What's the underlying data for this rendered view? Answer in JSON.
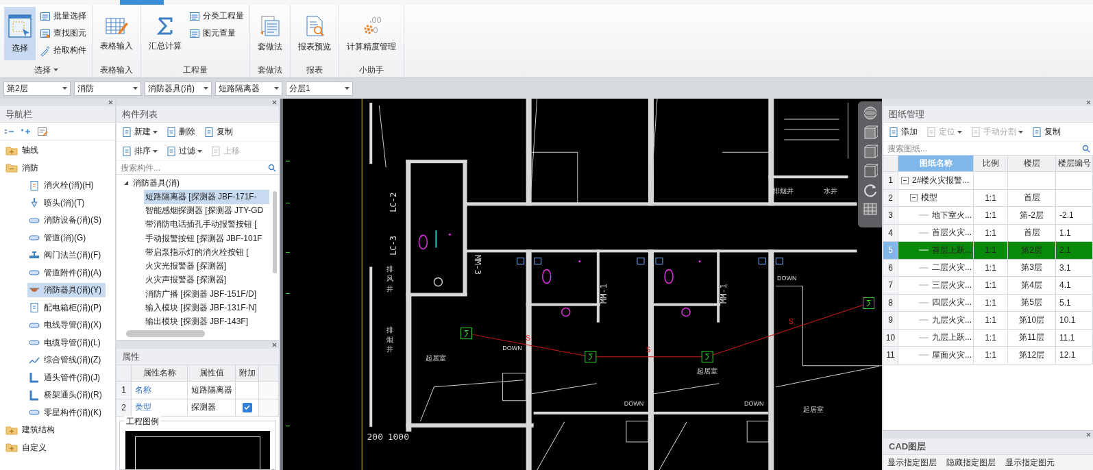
{
  "ribbon": {
    "groups": [
      {
        "label": "选择",
        "menu": true,
        "large": [
          {
            "label": "选择",
            "selected": true
          }
        ],
        "small": [
          {
            "label": "批量选择"
          },
          {
            "label": "查找图元"
          },
          {
            "label": "拾取构件"
          }
        ]
      },
      {
        "label": "表格输入",
        "menu": false,
        "large": [
          {
            "label": "表格输入",
            "selected": false
          }
        ]
      },
      {
        "label": "工程量",
        "menu": false,
        "large": [
          {
            "label": "汇总计算",
            "selected": false
          }
        ],
        "small": [
          {
            "label": "分类工程量"
          },
          {
            "label": "图元查量"
          }
        ]
      },
      {
        "label": "套做法",
        "menu": false,
        "large": [
          {
            "label": "套做法",
            "selected": false
          }
        ]
      },
      {
        "label": "报表",
        "menu": false,
        "large": [
          {
            "label": "报表预览",
            "selected": false
          }
        ]
      },
      {
        "label": "小助手",
        "menu": false,
        "large": [
          {
            "label": "计算精度管理",
            "selected": false
          }
        ]
      }
    ]
  },
  "level_bar": {
    "dropdowns": [
      "第2层",
      "消防",
      "消防器具(消)",
      "短路隔离器",
      "分层1"
    ]
  },
  "navigation": {
    "title": "导航栏",
    "tree": [
      {
        "label": "轴线",
        "expanded": false
      },
      {
        "label": "消防",
        "expanded": true,
        "children": [
          {
            "label": "消火栓(消)(H)",
            "selected": false
          },
          {
            "label": "喷头(消)(T)",
            "selected": false
          },
          {
            "label": "消防设备(消)(S)",
            "selected": false
          },
          {
            "label": "管道(消)(G)",
            "selected": false
          },
          {
            "label": "阀门法兰(消)(F)",
            "selected": false
          },
          {
            "label": "管道附件(消)(A)",
            "selected": false
          },
          {
            "label": "消防器具(消)(Y)",
            "selected": true
          },
          {
            "label": "配电箱柜(消)(P)",
            "selected": false
          },
          {
            "label": "电线导管(消)(X)",
            "selected": false
          },
          {
            "label": "电缆导管(消)(L)",
            "selected": false
          },
          {
            "label": "综合管线(消)(Z)",
            "selected": false
          },
          {
            "label": "通头管件(消)(J)",
            "selected": false
          },
          {
            "label": "桥架通头(消)(R)",
            "selected": false
          },
          {
            "label": "零星构件(消)(K)",
            "selected": false
          }
        ]
      },
      {
        "label": "建筑结构",
        "expanded": false
      },
      {
        "label": "自定义",
        "expanded": false
      }
    ]
  },
  "component_list": {
    "title": "构件列表",
    "toolbar": [
      [
        {
          "label": "新建",
          "menu": true,
          "disabled": false
        },
        {
          "label": "删除",
          "menu": false,
          "disabled": false
        },
        {
          "label": "复制",
          "menu": false,
          "disabled": false
        }
      ],
      [
        {
          "label": "排序",
          "menu": true,
          "disabled": false
        },
        {
          "label": "过滤",
          "menu": true,
          "disabled": false
        },
        {
          "label": "上移",
          "menu": false,
          "disabled": true
        }
      ]
    ],
    "search": {
      "placeholder": "搜索构件..."
    },
    "tree": {
      "label": "消防器具(消)",
      "expanded": true,
      "children": [
        {
          "label": "短路隔离器 [探测器 JBF-171F-",
          "selected": true
        },
        {
          "label": "智能感烟探测器 [探测器 JTY-GD",
          "selected": false
        },
        {
          "label": "带消防电话插孔手动报警按钮 [",
          "selected": false
        },
        {
          "label": "手动报警按钮 [探测器 JBF-101F",
          "selected": false
        },
        {
          "label": "带启泵指示灯的消火栓按钮 [",
          "selected": false
        },
        {
          "label": "火灾光报警器 [探测器]",
          "selected": false
        },
        {
          "label": "火灾声报警器 [探测器]",
          "selected": false
        },
        {
          "label": "消防广播 [探测器 JBF-151F/D]",
          "selected": false
        },
        {
          "label": "输入模块 [探测器 JBF-131F-N]",
          "selected": false
        },
        {
          "label": "输出模块 [探测器 JBF-143F]",
          "selected": false
        }
      ]
    }
  },
  "properties": {
    "title": "属性",
    "columns": [
      "属性名称",
      "属性值",
      "附加"
    ],
    "rows": [
      {
        "num": "1",
        "name": "名称",
        "value": "短路隔离器",
        "extra": false
      },
      {
        "num": "2",
        "name": "类型",
        "value": "探测器",
        "extra": true
      }
    ]
  },
  "legend": {
    "title": "工程图例"
  },
  "cad_labels": [
    "LC-2",
    "LC-3",
    "MM-3",
    "MM-1",
    "MM-1",
    "200",
    "1000",
    "DOWN",
    "DOWN",
    "DOWN",
    "DOWN",
    "起居室",
    "起居室",
    "起居室",
    "排烟井",
    "水井",
    "排风井",
    "排烟井",
    "S",
    "S",
    "S"
  ],
  "drawings": {
    "title": "图纸管理",
    "toolbar": [
      {
        "label": "添加",
        "menu": false,
        "disabled": false
      },
      {
        "label": "定位",
        "menu": true,
        "disabled": true
      },
      {
        "label": "手动分割",
        "menu": true,
        "disabled": true
      },
      {
        "label": "复制",
        "menu": false,
        "disabled": false
      }
    ],
    "search": {
      "placeholder": "搜索图纸..."
    },
    "columns": [
      {
        "label": "图纸名称",
        "selected": true
      },
      {
        "label": "比例",
        "selected": false
      },
      {
        "label": "楼层",
        "selected": false
      },
      {
        "label": "楼层编号",
        "selected": false
      }
    ],
    "rows": [
      {
        "num": "1",
        "name": "2#楼火灾报警...",
        "expanded": true,
        "selected": false,
        "children": [
          {
            "num": "2",
            "name": "模型",
            "scale": "1:1",
            "floor": "首层",
            "expanded": true,
            "selected": false,
            "children": [
              {
                "num": "3",
                "name": "地下室火...",
                "scale": "1:1",
                "floor": "第-2层",
                "code": "-2.1",
                "selected": false
              },
              {
                "num": "4",
                "name": "首层火灾...",
                "scale": "1:1",
                "floor": "首层",
                "code": "1.1",
                "selected": false
              },
              {
                "num": "5",
                "name": "首层上跃...",
                "scale": "1:1",
                "floor": "第2层",
                "code": "2.1",
                "selected": true
              },
              {
                "num": "6",
                "name": "二层火灾...",
                "scale": "1:1",
                "floor": "第3层",
                "code": "3.1",
                "selected": false
              },
              {
                "num": "7",
                "name": "三层火灾...",
                "scale": "1:1",
                "floor": "第4层",
                "code": "4.1",
                "selected": false
              },
              {
                "num": "8",
                "name": "四层火灾...",
                "scale": "1:1",
                "floor": "第5层",
                "code": "5.1",
                "selected": false
              },
              {
                "num": "9",
                "name": "九层火灾...",
                "scale": "1:1",
                "floor": "第10层",
                "code": "10.1",
                "selected": false
              },
              {
                "num": "10",
                "name": "九层上跃...",
                "scale": "1:1",
                "floor": "第11层",
                "code": "11.1",
                "selected": false
              },
              {
                "num": "11",
                "name": "屋面火灾...",
                "scale": "1:1",
                "floor": "第12层",
                "code": "12.1",
                "selected": false
              }
            ]
          }
        ]
      }
    ]
  },
  "cad_layers": {
    "title": "CAD图层",
    "buttons": [
      "显示指定图层",
      "隐藏指定图层",
      "显示指定图元"
    ]
  }
}
